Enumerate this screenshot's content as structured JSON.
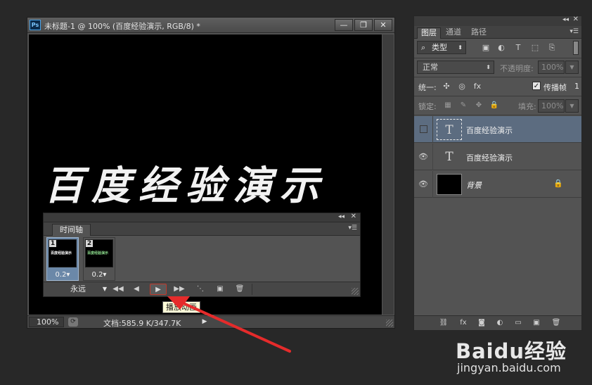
{
  "document": {
    "ps_badge": "Ps",
    "title": "未标题-1 @ 100% (百度经验演示, RGB/8) *",
    "canvas_text": "百度经验演示",
    "window_buttons": [
      "—",
      "❐",
      "✕"
    ],
    "status": {
      "zoom": "100%",
      "doc_info": "文档:585.9 K/347.7K",
      "arrow": "▶"
    }
  },
  "timeline": {
    "tab_label": "时间轴",
    "frames": [
      {
        "number": "1",
        "thumb_text": "百度经验演示",
        "delay": "0.2▾"
      },
      {
        "number": "2",
        "thumb_text": "百度经验演示",
        "delay": "0.2▾"
      }
    ],
    "loop_value": "永远",
    "controls": {
      "first": "◀◀",
      "prev": "◀",
      "play": "▶",
      "next": "▶▶",
      "tween": "⋱",
      "duplicate": "▣",
      "delete": "🗑"
    },
    "tooltip": "播放动画"
  },
  "layers_panel": {
    "tabs": [
      "图层",
      "通道",
      "路径"
    ],
    "filter_label": "类型",
    "blend_mode": "正常",
    "opacity_label": "不透明度:",
    "opacity_value": "100%",
    "unify_label": "统一:",
    "propagate_label": "传播帧",
    "propagate_value": "1",
    "lock_label": "锁定:",
    "fill_label": "填充:",
    "fill_value": "100%",
    "layers": [
      {
        "name": "百度经验演示",
        "type_glyph": "T",
        "visible": false,
        "selected": true
      },
      {
        "name": "百度经验演示",
        "type_glyph": "T",
        "visible": true,
        "selected": false
      },
      {
        "name": "背景",
        "visible": true,
        "locked": true
      }
    ]
  },
  "watermark": {
    "logo": "Baidu经验",
    "url": "jingyan.baidu.com"
  },
  "colors": {
    "ui_background": "#535353",
    "canvas": "#000000",
    "selected_layer": "#5c6c80",
    "annotation_red": "#e52b2b",
    "tooltip_bg": "#fefcd8"
  }
}
